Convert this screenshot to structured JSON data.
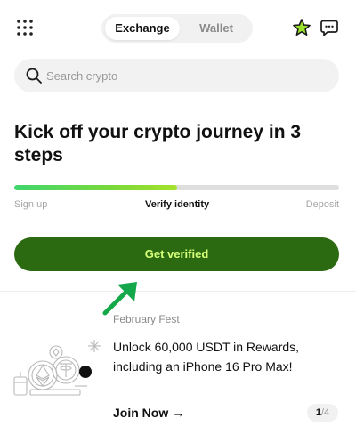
{
  "header": {
    "tabs": [
      {
        "label": "Exchange",
        "active": true
      },
      {
        "label": "Wallet",
        "active": false
      }
    ],
    "icons": [
      "grid-menu-icon",
      "star-icon",
      "chat-icon"
    ]
  },
  "search": {
    "placeholder": "Search crypto"
  },
  "onboarding": {
    "headline": "Kick off your crypto journey in 3 steps",
    "progress": 0.5,
    "steps": [
      {
        "label": "Sign up",
        "state": "done"
      },
      {
        "label": "Verify identity",
        "state": "current"
      },
      {
        "label": "Deposit",
        "state": "pending"
      }
    ],
    "cta_label": "Get verified"
  },
  "promo": {
    "tag": "February Fest",
    "title": "Unlock 60,000 USDT in Rewards, including an iPhone 16 Pro Max!",
    "link_label": "Join Now",
    "link_arrow": "→",
    "pager_current": "1",
    "pager_total": "/4"
  },
  "colors": {
    "accent_green": "#2c6a12",
    "cta_text": "#d6ff7a",
    "progress_fill": "#7ad93a",
    "annotation_arrow": "#14a84a"
  }
}
